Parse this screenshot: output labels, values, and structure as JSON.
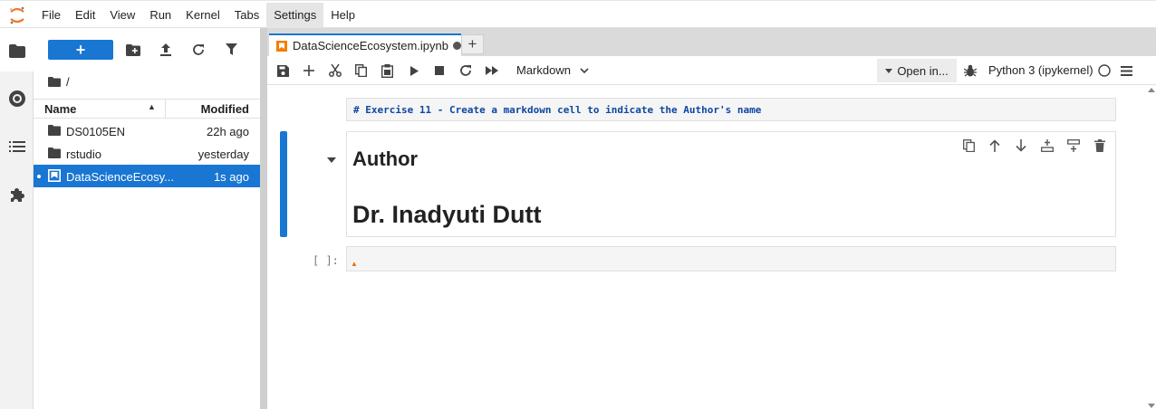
{
  "menu": {
    "items": [
      "File",
      "Edit",
      "View",
      "Run",
      "Kernel",
      "Tabs",
      "Settings",
      "Help"
    ],
    "active_index": 6
  },
  "leftstrip": {
    "icons": [
      "folder-icon",
      "running-icon",
      "toc-icon",
      "extension-icon"
    ]
  },
  "filebrowser": {
    "new_label": "+",
    "breadcrumb": "/",
    "columns": {
      "name": "Name",
      "modified": "Modified"
    },
    "files": [
      {
        "name": "DS0105EN",
        "modified": "22h ago",
        "type": "folder"
      },
      {
        "name": "rstudio",
        "modified": "yesterday",
        "type": "folder"
      },
      {
        "name": "DataScienceEcosy...",
        "modified": "1s ago",
        "type": "notebook",
        "selected": true
      }
    ]
  },
  "tab": {
    "label": "DataScienceEcosystem.ipynb",
    "add_label": "+"
  },
  "toolbar": {
    "cell_type": "Markdown",
    "open_in": "Open in...",
    "kernel": "Python 3 (ipykernel)"
  },
  "cells": {
    "markdown_source": "# Exercise 11 - Create a markdown cell to indicate the Author's name",
    "heading2": "Author",
    "heading1": "Dr. Inadyuti Dutt",
    "empty_prompt": "[ ]:"
  },
  "colors": {
    "accent": "#1976d2",
    "code_blue": "#0d47a1",
    "logo_orange": "#f37626"
  }
}
